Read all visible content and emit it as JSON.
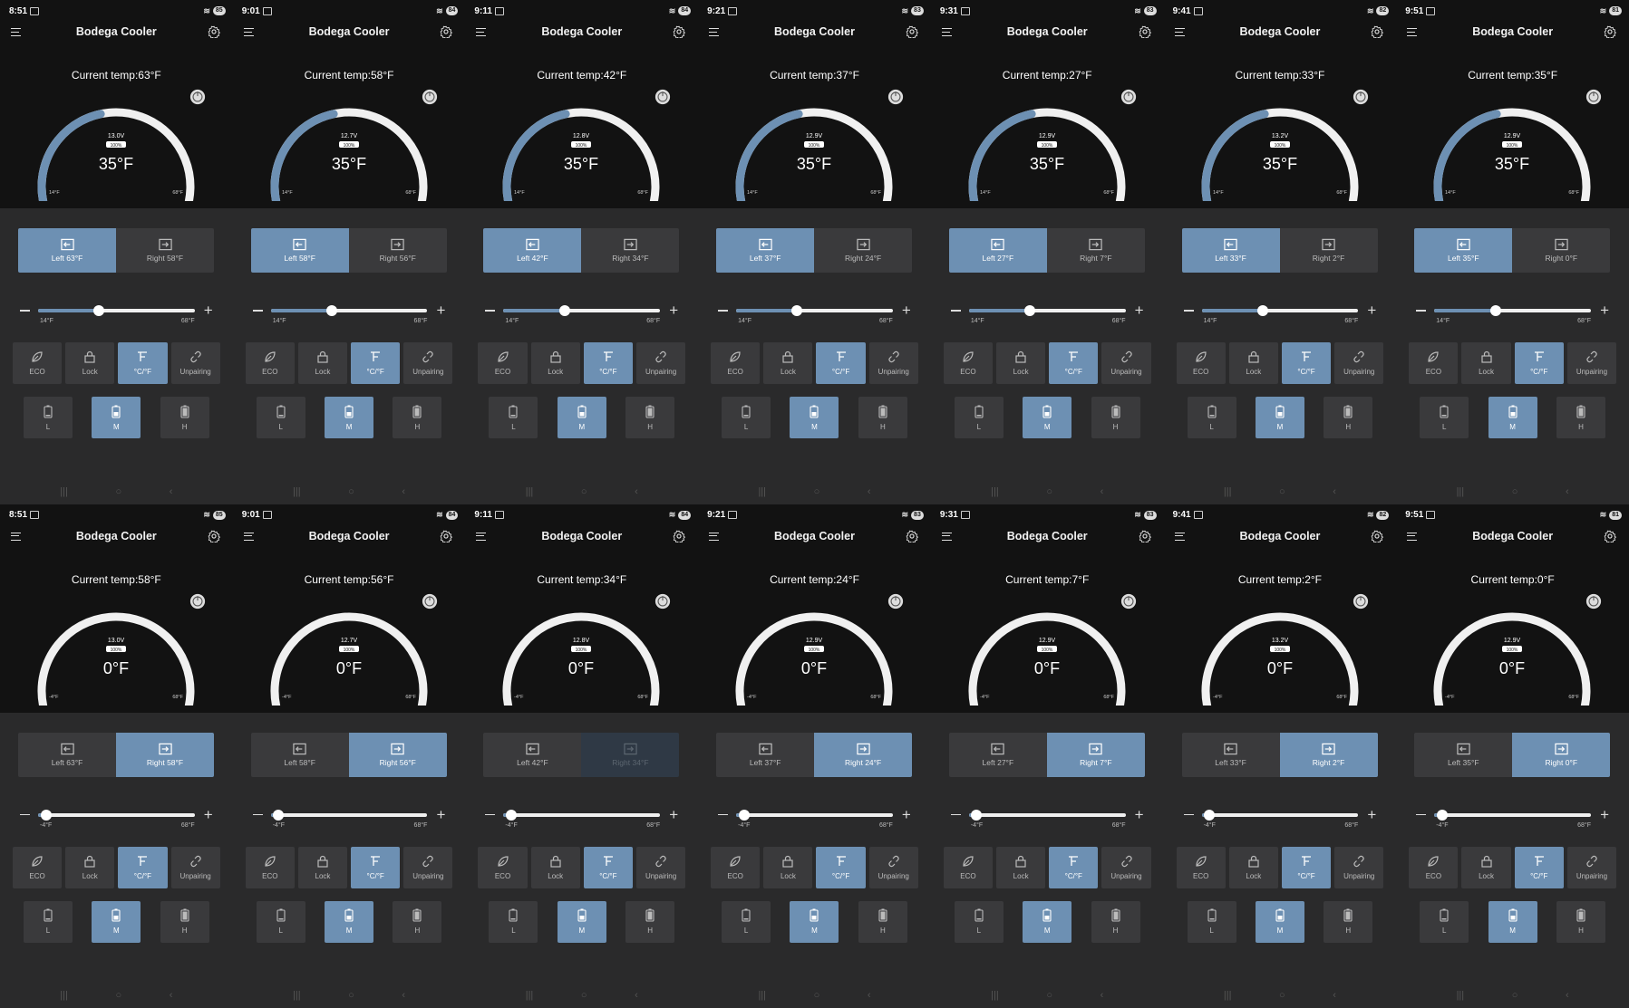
{
  "app_title": "Bodega Cooler",
  "colors": {
    "accent": "#6d90b3",
    "background": "#121212",
    "panel": "#2a2a2b",
    "button": "#3a3a3c"
  },
  "labels": {
    "current_temp_prefix": "Current temp:",
    "funcs": [
      "ECO",
      "Lock",
      "°C/°F",
      "Unpairing"
    ],
    "modes": [
      "L",
      "M",
      "H"
    ]
  },
  "icons": {
    "menu": "menu-icon",
    "settings": "gear-icon",
    "power": "power-icon",
    "zone_left": "arrow-left-box-icon",
    "zone_right": "arrow-right-box-icon",
    "eco": "leaf-icon",
    "lock": "lock-icon",
    "unit": "thermometer-unit-icon",
    "unpairing": "link-break-icon",
    "mode": "battery-level-icon"
  },
  "screens": [
    {
      "time": "8:51",
      "battery": "85",
      "current_temp": "63°F",
      "voltage": "13.0V",
      "percent": "100%",
      "setpoint": "35°F",
      "gauge_min": "14°F",
      "gauge_max": "68°F",
      "gauge_level": 0.39,
      "left_label": "Left 63°F",
      "right_label": "Right 58°F",
      "active_zone": "left",
      "slider_min": "14°F",
      "slider_max": "68°F",
      "slider_level": 0.39,
      "active_func": "°C/°F",
      "active_mode": "M"
    },
    {
      "time": "9:01",
      "battery": "84",
      "current_temp": "58°F",
      "voltage": "12.7V",
      "percent": "100%",
      "setpoint": "35°F",
      "gauge_min": "14°F",
      "gauge_max": "68°F",
      "gauge_level": 0.39,
      "left_label": "Left 58°F",
      "right_label": "Right 56°F",
      "active_zone": "left",
      "slider_min": "14°F",
      "slider_max": "68°F",
      "slider_level": 0.39,
      "active_func": "°C/°F",
      "active_mode": "M"
    },
    {
      "time": "9:11",
      "battery": "84",
      "current_temp": "42°F",
      "voltage": "12.8V",
      "percent": "100%",
      "setpoint": "35°F",
      "gauge_min": "14°F",
      "gauge_max": "68°F",
      "gauge_level": 0.39,
      "left_label": "Left 42°F",
      "right_label": "Right 34°F",
      "active_zone": "left",
      "slider_min": "14°F",
      "slider_max": "68°F",
      "slider_level": 0.39,
      "active_func": "°C/°F",
      "active_mode": "M"
    },
    {
      "time": "9:21",
      "battery": "83",
      "current_temp": "37°F",
      "voltage": "12.9V",
      "percent": "100%",
      "setpoint": "35°F",
      "gauge_min": "14°F",
      "gauge_max": "68°F",
      "gauge_level": 0.39,
      "left_label": "Left 37°F",
      "right_label": "Right 24°F",
      "active_zone": "left",
      "slider_min": "14°F",
      "slider_max": "68°F",
      "slider_level": 0.39,
      "active_func": "°C/°F",
      "active_mode": "M"
    },
    {
      "time": "9:31",
      "battery": "83",
      "current_temp": "27°F",
      "voltage": "12.9V",
      "percent": "100%",
      "setpoint": "35°F",
      "gauge_min": "14°F",
      "gauge_max": "68°F",
      "gauge_level": 0.39,
      "left_label": "Left 27°F",
      "right_label": "Right 7°F",
      "active_zone": "left",
      "slider_min": "14°F",
      "slider_max": "68°F",
      "slider_level": 0.39,
      "active_func": "°C/°F",
      "active_mode": "M"
    },
    {
      "time": "9:41",
      "battery": "82",
      "current_temp": "33°F",
      "voltage": "13.2V",
      "percent": "100%",
      "setpoint": "35°F",
      "gauge_min": "14°F",
      "gauge_max": "68°F",
      "gauge_level": 0.39,
      "left_label": "Left 33°F",
      "right_label": "Right 2°F",
      "active_zone": "left",
      "slider_min": "14°F",
      "slider_max": "68°F",
      "slider_level": 0.39,
      "active_func": "°C/°F",
      "active_mode": "M"
    },
    {
      "time": "9:51",
      "battery": "81",
      "current_temp": "35°F",
      "voltage": "12.9V",
      "percent": "100%",
      "setpoint": "35°F",
      "gauge_min": "14°F",
      "gauge_max": "68°F",
      "gauge_level": 0.39,
      "left_label": "Left 35°F",
      "right_label": "Right 0°F",
      "active_zone": "left",
      "slider_min": "14°F",
      "slider_max": "68°F",
      "slider_level": 0.39,
      "active_func": "°C/°F",
      "active_mode": "M"
    },
    {
      "time": "8:51",
      "battery": "85",
      "current_temp": "58°F",
      "voltage": "13.0V",
      "percent": "100%",
      "setpoint": "0°F",
      "gauge_min": "-4°F",
      "gauge_max": "68°F",
      "gauge_level": 0.05,
      "left_label": "Left 63°F",
      "right_label": "Right 58°F",
      "active_zone": "right",
      "slider_min": "-4°F",
      "slider_max": "68°F",
      "slider_level": 0.05,
      "active_func": "°C/°F",
      "active_mode": "M"
    },
    {
      "time": "9:01",
      "battery": "84",
      "current_temp": "56°F",
      "voltage": "12.7V",
      "percent": "100%",
      "setpoint": "0°F",
      "gauge_min": "-4°F",
      "gauge_max": "68°F",
      "gauge_level": 0.05,
      "left_label": "Left 58°F",
      "right_label": "Right 56°F",
      "active_zone": "right",
      "slider_min": "-4°F",
      "slider_max": "68°F",
      "slider_level": 0.05,
      "active_func": "°C/°F",
      "active_mode": "M"
    },
    {
      "time": "9:11",
      "battery": "84",
      "current_temp": "34°F",
      "voltage": "12.8V",
      "percent": "100%",
      "setpoint": "0°F",
      "gauge_min": "-4°F",
      "gauge_max": "68°F",
      "gauge_level": 0.05,
      "left_label": "Left 42°F",
      "right_label": "Right 34°F",
      "active_zone": "right-dim",
      "slider_min": "-4°F",
      "slider_max": "68°F",
      "slider_level": 0.05,
      "active_func": "°C/°F",
      "active_mode": "M"
    },
    {
      "time": "9:21",
      "battery": "83",
      "current_temp": "24°F",
      "voltage": "12.9V",
      "percent": "100%",
      "setpoint": "0°F",
      "gauge_min": "-4°F",
      "gauge_max": "68°F",
      "gauge_level": 0.05,
      "left_label": "Left 37°F",
      "right_label": "Right 24°F",
      "active_zone": "right",
      "slider_min": "-4°F",
      "slider_max": "68°F",
      "slider_level": 0.05,
      "active_func": "°C/°F",
      "active_mode": "M"
    },
    {
      "time": "9:31",
      "battery": "83",
      "current_temp": "7°F",
      "voltage": "12.9V",
      "percent": "100%",
      "setpoint": "0°F",
      "gauge_min": "-4°F",
      "gauge_max": "68°F",
      "gauge_level": 0.05,
      "left_label": "Left 27°F",
      "right_label": "Right 7°F",
      "active_zone": "right",
      "slider_min": "-4°F",
      "slider_max": "68°F",
      "slider_level": 0.05,
      "active_func": "°C/°F",
      "active_mode": "M"
    },
    {
      "time": "9:41",
      "battery": "82",
      "current_temp": "2°F",
      "voltage": "13.2V",
      "percent": "100%",
      "setpoint": "0°F",
      "gauge_min": "-4°F",
      "gauge_max": "68°F",
      "gauge_level": 0.05,
      "left_label": "Left 33°F",
      "right_label": "Right 2°F",
      "active_zone": "right",
      "slider_min": "-4°F",
      "slider_max": "68°F",
      "slider_level": 0.05,
      "active_func": "°C/°F",
      "active_mode": "M"
    },
    {
      "time": "9:51",
      "battery": "81",
      "current_temp": "0°F",
      "voltage": "12.9V",
      "percent": "100%",
      "setpoint": "0°F",
      "gauge_min": "-4°F",
      "gauge_max": "68°F",
      "gauge_level": 0.05,
      "left_label": "Left 35°F",
      "right_label": "Right 0°F",
      "active_zone": "right",
      "slider_min": "-4°F",
      "slider_max": "68°F",
      "slider_level": 0.05,
      "active_func": "°C/°F",
      "active_mode": "M"
    }
  ]
}
